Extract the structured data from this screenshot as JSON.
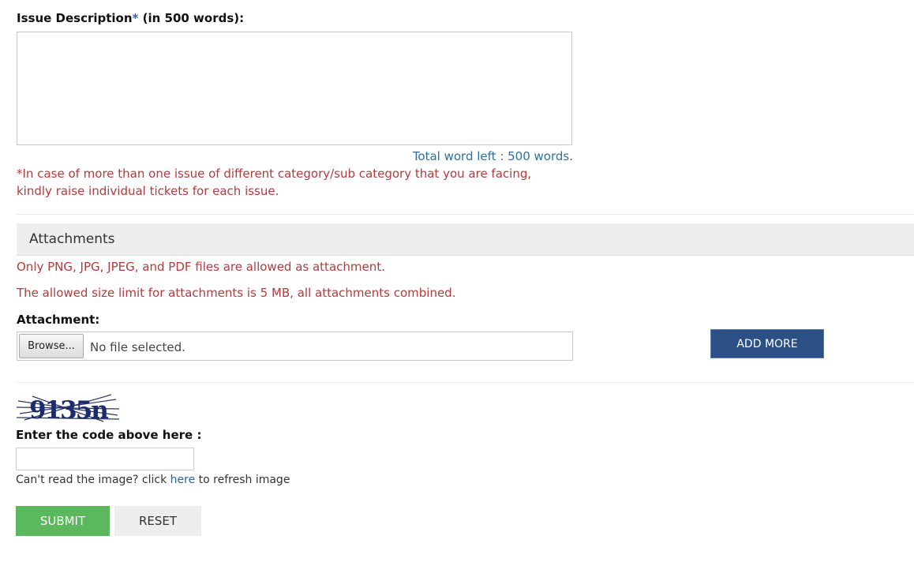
{
  "issue": {
    "label": "Issue Description",
    "required_mark": "*",
    "label_suffix": " (in 500 words):",
    "textarea_value": "",
    "word_counter": "Total word left : 500 words."
  },
  "notes": {
    "multi_issue_line1": "*In case of more than one issue of different category/sub category that you are facing,",
    "multi_issue_line2": "kindly raise individual tickets for each issue."
  },
  "attachments": {
    "section_title": "Attachments",
    "allowed_types": "Only PNG, JPG, JPEG, and PDF files are allowed as attachment.",
    "size_limit": "The allowed size limit for attachments is 5 MB, all attachments combined.",
    "field_label": "Attachment:",
    "browse_label": "Browse...",
    "file_status": "No file selected.",
    "add_more_label": "ADD MORE"
  },
  "captcha": {
    "image_text": "9135n",
    "prompt": "Enter the code above here :",
    "input_value": "",
    "refresh_prefix": "Can't read the image? click ",
    "refresh_link": "here",
    "refresh_suffix": " to refresh image"
  },
  "actions": {
    "submit_label": "SUBMIT",
    "reset_label": "RESET"
  },
  "colors": {
    "accent_blue": "#2c4f86",
    "submit_green": "#5cb85c",
    "warning_red": "#b23b3b",
    "counter_blue": "#2e6f9e",
    "link_blue": "#2a62a6"
  }
}
